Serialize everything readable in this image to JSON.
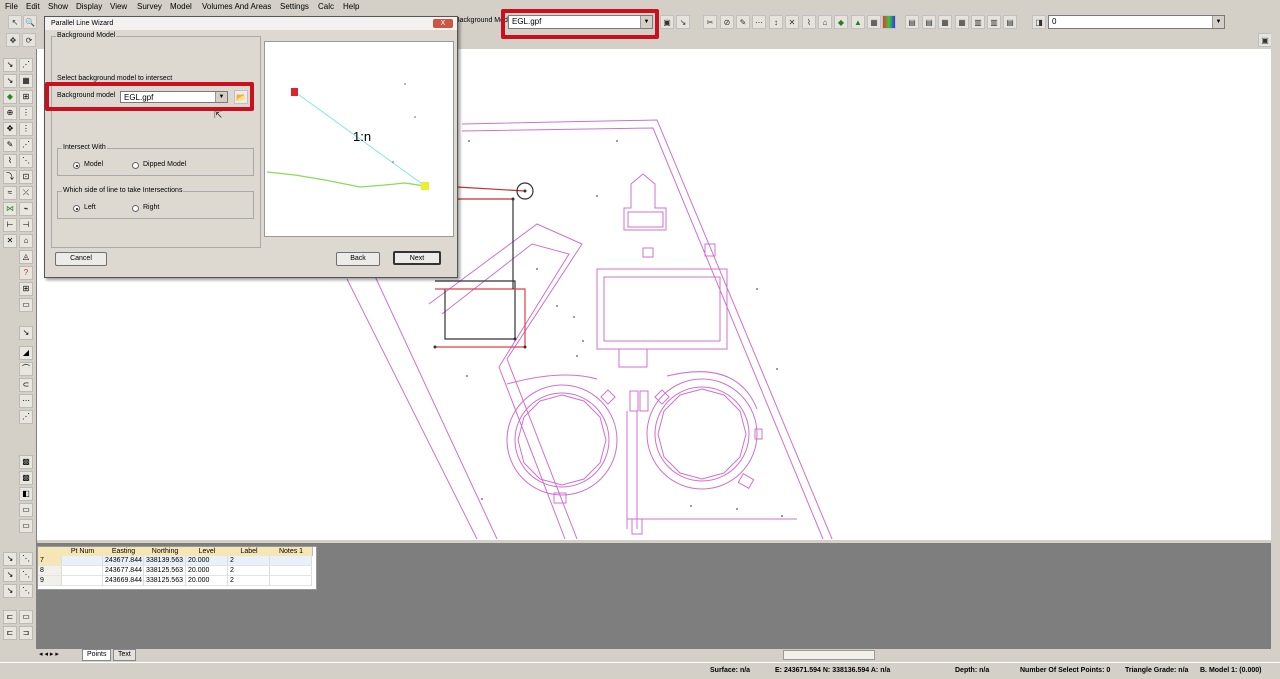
{
  "menu": [
    "File",
    "Edit",
    "Show",
    "Display",
    "View",
    "Survey",
    "Model",
    "Volumes And Areas",
    "Settings",
    "Calc",
    "Help"
  ],
  "toolbar": {
    "background_model_label": "Background Model",
    "background_model_value": "EGL.gpf",
    "layer_value": "0"
  },
  "dialog": {
    "title": "Parallel Line Wizard",
    "close_label": "X",
    "group_title": "Background Model",
    "instruction": "Select background model to intersect",
    "bg_model_label": "Background model",
    "bg_model_value": "EGL.gpf",
    "intersect_title": "Intersect With",
    "intersect_opt1": "Model",
    "intersect_opt2": "Dipped Model",
    "side_title": "Which side of line to take Intersections",
    "side_opt1": "Left",
    "side_opt2": "Right",
    "preview_label": "1:n",
    "cancel_label": "Cancel",
    "back_label": "Back",
    "next_label": "Next"
  },
  "grid": {
    "columns": [
      "Pt Num",
      "Easting",
      "Northing",
      "Level",
      "Label",
      "Notes 1"
    ],
    "rows": [
      {
        "num": "7",
        "easting": "243677.844",
        "northing": "338139.563",
        "level": "20.000",
        "label": "2"
      },
      {
        "num": "8",
        "easting": "243677.844",
        "northing": "338125.563",
        "level": "20.000",
        "label": "2"
      },
      {
        "num": "9",
        "easting": "243669.844",
        "northing": "338125.563",
        "level": "20.000",
        "label": "2"
      }
    ]
  },
  "tabs": [
    "Points",
    "Text"
  ],
  "status": {
    "surface": "Surface: n/a",
    "coords": "E: 243671.594  N: 338136.594  A: n/a",
    "depth": "Depth: n/a",
    "select_points": "Number Of Select Points: 0",
    "triangle_grade": "Triangle Grade: n/a",
    "model": "B. Model 1: (0.000)"
  },
  "colors": {
    "highlight": "#c8101e",
    "magenta_lines": "#d070d0",
    "preview_line": "#80e8e0",
    "preview_ground": "#88dd55"
  }
}
